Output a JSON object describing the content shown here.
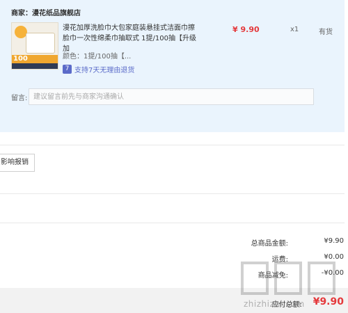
{
  "order": {
    "merchant_label": "商家：",
    "merchant_name": "漫花纸品旗舰店",
    "product_title": "漫花加厚洗脸巾大包家庭装悬挂式洁面巾擦脸巾一次性绵柔巾抽取式 1提/100抽【升级加",
    "price": "¥ 9.90",
    "quantity": "x1",
    "stock": "有货",
    "spec": "颜色：1提/100抽【...",
    "returns_text": "支持7天无理由退货",
    "returns_icon": "7",
    "thumb_number": "100"
  },
  "message": {
    "label": "留言:",
    "placeholder": "建议留言前先与商家沟通确认"
  },
  "invoice": {
    "button_label": "影响报销"
  },
  "summary": {
    "rows": [
      {
        "label": "总商品金额:",
        "value": "¥9.90"
      },
      {
        "label": "运费:",
        "value": "¥0.00"
      },
      {
        "label": "商品减免:",
        "value": "-¥0.00"
      }
    ],
    "total_label": "应付总额:",
    "total_value": "¥9.90"
  },
  "watermark": {
    "text": "zhizhizhi.com"
  }
}
